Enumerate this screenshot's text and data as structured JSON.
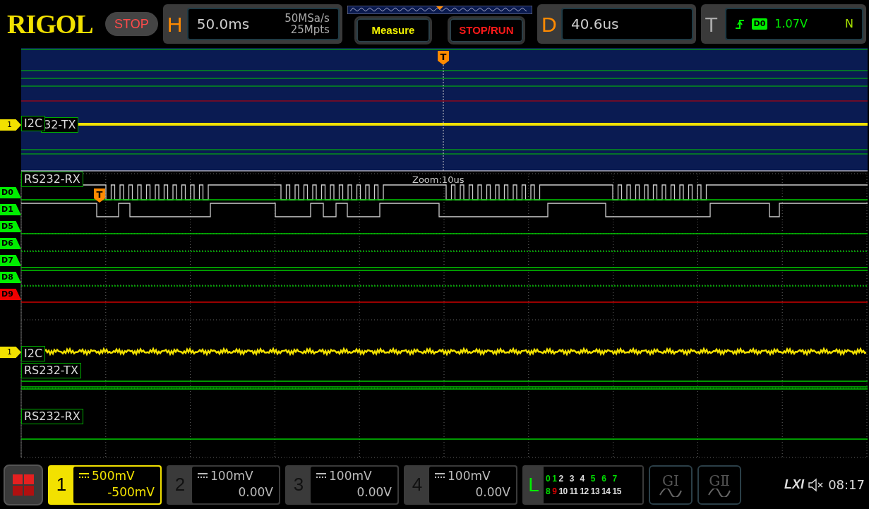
{
  "header": {
    "logo": "RIGOL",
    "run_status": "STOP"
  },
  "horizontal": {
    "label": "H",
    "timebase": "50.0ms",
    "sample_rate": "50MSa/s",
    "memory_depth": "25Mpts"
  },
  "buttons": [
    {
      "label": "Measure",
      "kind": "measure"
    },
    {
      "label": "STOP/RUN",
      "kind": "run_stop"
    }
  ],
  "delay": {
    "label": "D",
    "value": "40.6us"
  },
  "trigger": {
    "label": "T",
    "source": "D0",
    "level": "1.07V",
    "sweep": "N"
  },
  "overview": {
    "trigger_marker": "T",
    "channel_marker": "1",
    "decode_labels": [
      "I2C",
      "32-TX"
    ]
  },
  "zoom": {
    "title": "Zoom:10us",
    "trigger_marker": "T",
    "channel_marker": "1",
    "decode_labels": [
      "RS232-RX",
      "I2C",
      "RS232-TX",
      "RS232-RX"
    ]
  },
  "digital_channels": [
    {
      "label": "D0",
      "color": "#00ee00"
    },
    {
      "label": "D1",
      "color": "#00ee00"
    },
    {
      "label": "D5",
      "color": "#00ee00"
    },
    {
      "label": "D6",
      "color": "#00ee00"
    },
    {
      "label": "D7",
      "color": "#00ee00"
    },
    {
      "label": "D8",
      "color": "#00ee00"
    },
    {
      "label": "D9",
      "color": "#ee0000"
    }
  ],
  "analog_channels": [
    {
      "number": "1",
      "scale": "500mV",
      "offset": "-500mV",
      "on": true
    },
    {
      "number": "2",
      "scale": "100mV",
      "offset": "0.00V",
      "on": false
    },
    {
      "number": "3",
      "scale": "100mV",
      "offset": "0.00V",
      "on": false
    },
    {
      "number": "4",
      "scale": "100mV",
      "offset": "0.00V",
      "on": false
    }
  ],
  "logic": {
    "label": "L",
    "bits": [
      {
        "text": "0",
        "color": "#00dd00"
      },
      {
        "text": "1",
        "color": "#00dd00"
      },
      {
        "text": "2",
        "color": "#dddddd"
      },
      {
        "text": "3",
        "color": "#dddddd"
      },
      {
        "text": "4",
        "color": "#dddddd"
      },
      {
        "text": "5",
        "color": "#00dd00"
      },
      {
        "text": "6",
        "color": "#00dd00"
      },
      {
        "text": "7",
        "color": "#00dd00"
      },
      {
        "text": "8",
        "color": "#00dd00"
      },
      {
        "text": "9",
        "color": "#dd0000"
      },
      {
        "text": "10",
        "color": "#dddddd"
      },
      {
        "text": "11",
        "color": "#dddddd"
      },
      {
        "text": "12",
        "color": "#dddddd"
      },
      {
        "text": "13",
        "color": "#dddddd"
      },
      {
        "text": "14",
        "color": "#dddddd"
      },
      {
        "text": "15",
        "color": "#dddddd"
      }
    ]
  },
  "math": [
    {
      "label": "GⅠ"
    },
    {
      "label": "GⅡ"
    }
  ],
  "status": {
    "lxi": "LXI",
    "muted": true,
    "time": "08:17"
  }
}
